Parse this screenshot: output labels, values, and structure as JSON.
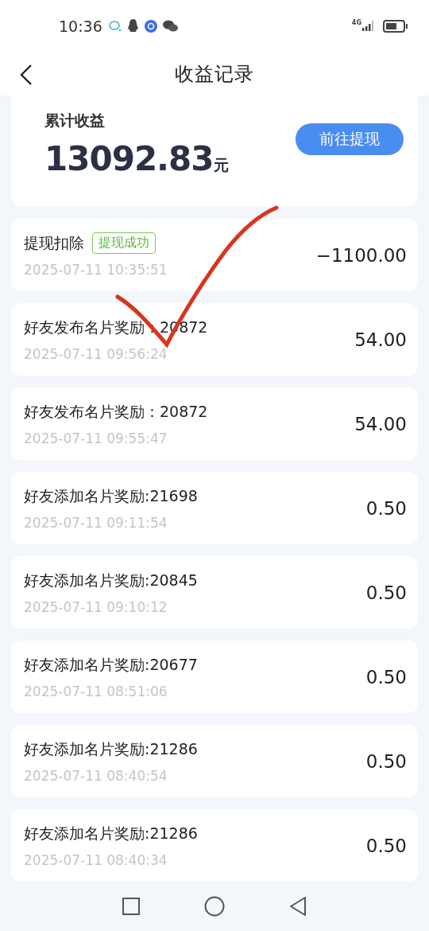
{
  "status_bar": {
    "time": "10:36",
    "network": "4G"
  },
  "header": {
    "title": "收益记录"
  },
  "summary": {
    "label": "累计收益",
    "amount": "13092.83",
    "unit": "元",
    "button": "前往提现"
  },
  "records": [
    {
      "title": "提现扣除",
      "badge": "提现成功",
      "time": "2025-07-11 10:35:51",
      "amount": "−1100.00"
    },
    {
      "title": "好友发布名片奖励：20872",
      "time": "2025-07-11 09:56:24",
      "amount": "54.00"
    },
    {
      "title": "好友发布名片奖励：20872",
      "time": "2025-07-11 09:55:47",
      "amount": "54.00"
    },
    {
      "title": "好友添加名片奖励:21698",
      "time": "2025-07-11 09:11:54",
      "amount": "0.50"
    },
    {
      "title": "好友添加名片奖励:20845",
      "time": "2025-07-11 09:10:12",
      "amount": "0.50"
    },
    {
      "title": "好友添加名片奖励:20677",
      "time": "2025-07-11 08:51:06",
      "amount": "0.50"
    },
    {
      "title": "好友添加名片奖励:21286",
      "time": "2025-07-11 08:40:54",
      "amount": "0.50"
    },
    {
      "title": "好友添加名片奖励:21286",
      "time": "2025-07-11 08:40:34",
      "amount": "0.50"
    }
  ],
  "annotation": {
    "kind": "checkmark"
  }
}
